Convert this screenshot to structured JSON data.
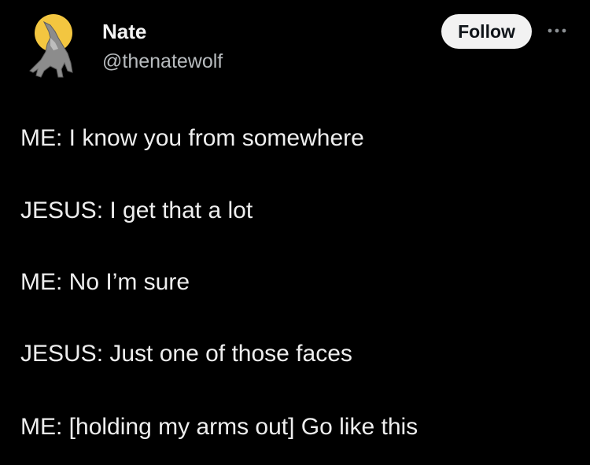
{
  "author": {
    "display_name": "Nate",
    "handle": "@thenatewolf",
    "avatar_icon": "howling-wolf-moon-icon"
  },
  "actions": {
    "follow_label": "Follow",
    "more_icon": "more-options-icon"
  },
  "tweet": {
    "lines": [
      "ME: I know you from somewhere",
      "JESUS: I get that a lot",
      "ME: No I’m sure",
      "JESUS: Just one of those faces",
      "ME: [holding my arms out] Go like this"
    ]
  },
  "colors": {
    "background": "#000000",
    "text": "#eeeeee",
    "handle": "#b8bcbf",
    "follow_button_bg": "#f2f2f2",
    "moon": "#f3c640"
  }
}
